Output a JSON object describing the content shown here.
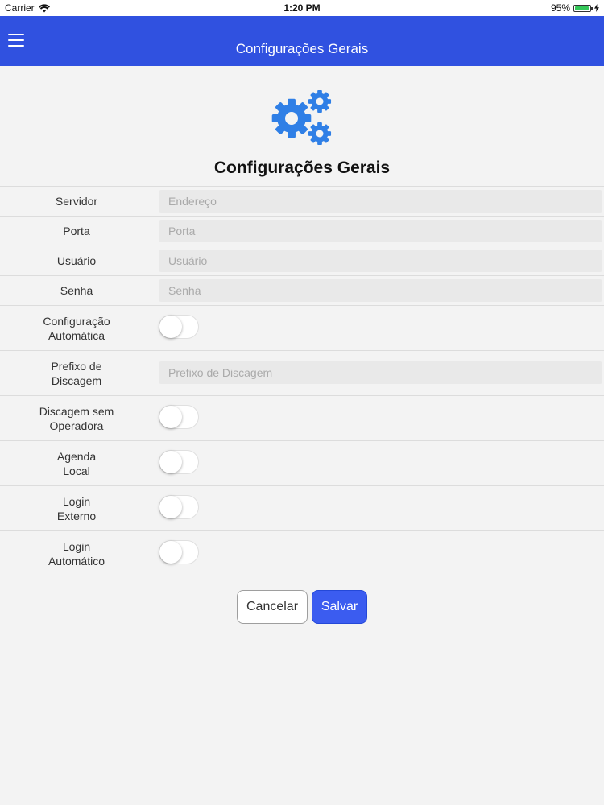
{
  "status_bar": {
    "carrier": "Carrier",
    "time": "1:20 PM",
    "battery_percent": "95%",
    "battery_level": 0.95
  },
  "navbar": {
    "title": "Configurações Gerais",
    "menu_icon": "hamburger-menu-icon",
    "background_color": "#3051e0"
  },
  "header": {
    "icon": "gears-icon",
    "title": "Configurações Gerais",
    "icon_color": "#2f7fe6"
  },
  "form": {
    "servidor": {
      "label": "Servidor",
      "placeholder": "Endereço",
      "value": ""
    },
    "porta": {
      "label": "Porta",
      "placeholder": "Porta",
      "value": ""
    },
    "usuario": {
      "label": "Usuário",
      "placeholder": "Usuário",
      "value": ""
    },
    "senha": {
      "label": "Senha",
      "placeholder": "Senha",
      "value": ""
    },
    "config_auto": {
      "label_line1": "Configuração",
      "label_line2": "Automática",
      "on": false
    },
    "prefixo": {
      "label_line1": "Prefixo de",
      "label_line2": "Discagem",
      "placeholder": "Prefixo de Discagem",
      "value": ""
    },
    "discagem_sem_op": {
      "label_line1": "Discagem sem",
      "label_line2": "Operadora",
      "on": false
    },
    "agenda_local": {
      "label_line1": "Agenda",
      "label_line2": "Local",
      "on": false
    },
    "login_externo": {
      "label_line1": "Login",
      "label_line2": "Externo",
      "on": false
    },
    "login_auto": {
      "label_line1": "Login",
      "label_line2": "Automático",
      "on": false
    }
  },
  "actions": {
    "cancel_label": "Cancelar",
    "save_label": "Salvar",
    "save_color": "#3b5cf0"
  }
}
